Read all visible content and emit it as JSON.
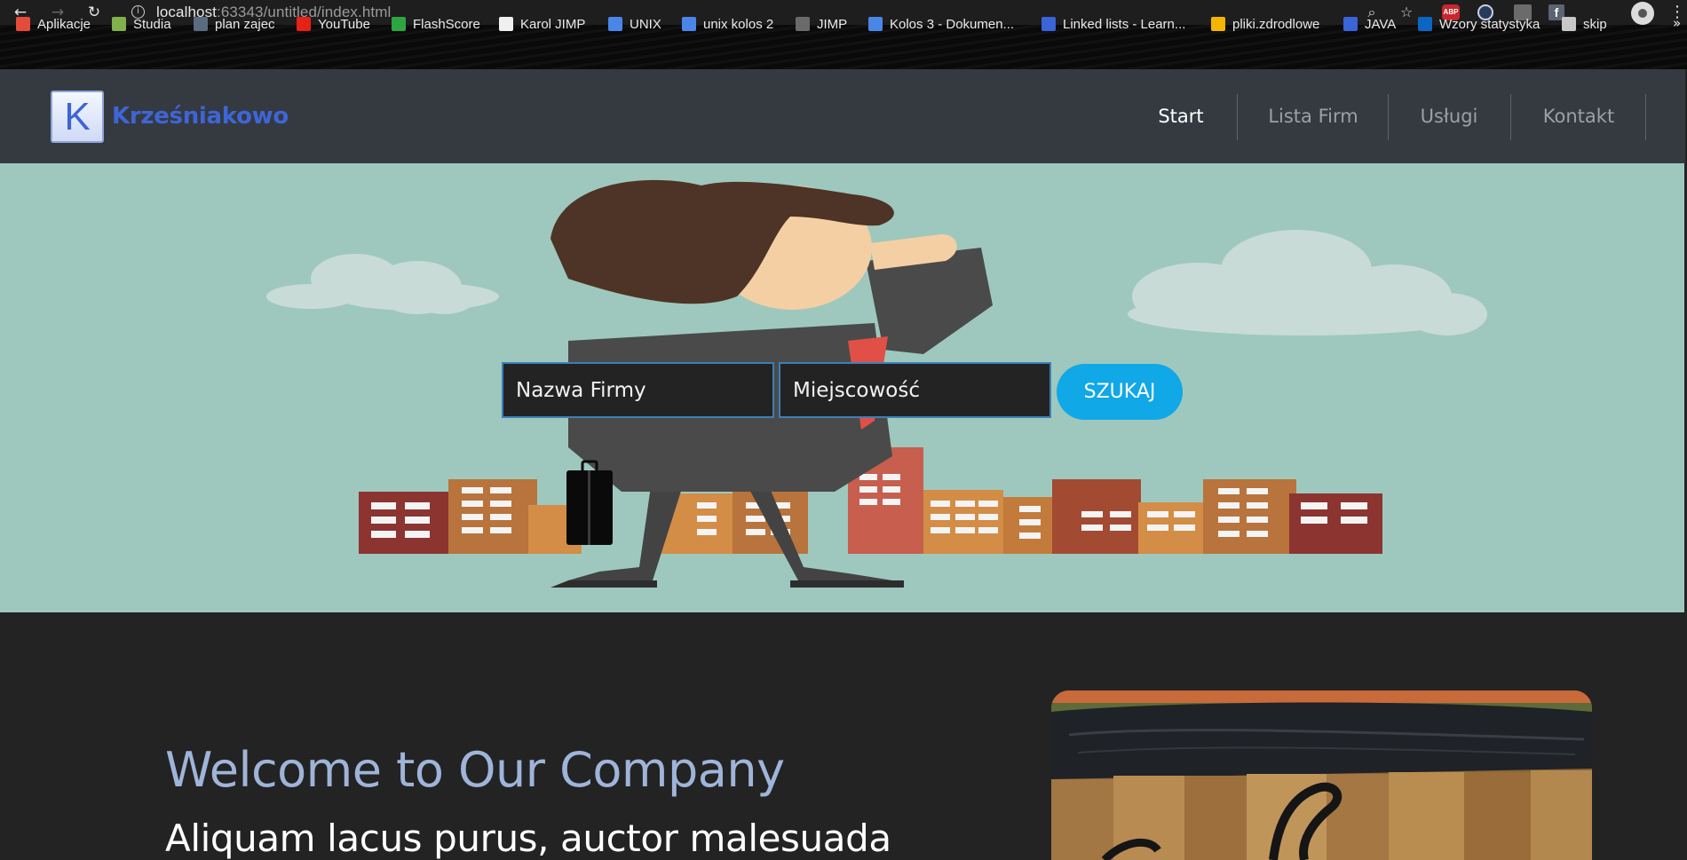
{
  "browser": {
    "url_host": "localhost",
    "url_rest": ":63343/untitled/index.html",
    "bookmarks": [
      {
        "label": "Aplikacje",
        "icon": "apps-grid-icon",
        "color": "#e34b3b"
      },
      {
        "label": "Studia",
        "icon": "notebook-icon",
        "color": "#7fb24a"
      },
      {
        "label": "plan zajec",
        "icon": "phone-icon",
        "color": "#5b6b80"
      },
      {
        "label": "YouTube",
        "icon": "youtube-icon",
        "color": "#e62117"
      },
      {
        "label": "FlashScore",
        "icon": "flashscore-icon",
        "color": "#2ea640"
      },
      {
        "label": "Karol JIMP",
        "icon": "github-icon",
        "color": "#f0f0f0"
      },
      {
        "label": "UNIX",
        "icon": "google-docs-icon",
        "color": "#4a86e8"
      },
      {
        "label": "unix kolos 2",
        "icon": "google-docs-icon",
        "color": "#4a86e8"
      },
      {
        "label": "JIMP",
        "icon": "image-icon",
        "color": "#6a6a6a"
      },
      {
        "label": "Kolos 3 - Dokumen...",
        "icon": "google-docs-icon",
        "color": "#4a86e8"
      },
      {
        "label": "Linked lists - Learn...",
        "icon": "c-letter-icon",
        "color": "#3a64d8"
      },
      {
        "label": "pliki.zdrodlowe",
        "icon": "google-drive-icon",
        "color": "#f4b400"
      },
      {
        "label": "JAVA",
        "icon": "sb-icon",
        "color": "#3a64d8"
      },
      {
        "label": "Wzory statystyka",
        "icon": "linkedin-icon",
        "color": "#0a66c2"
      },
      {
        "label": "skip",
        "icon": "globe-icon",
        "color": "#c8c8c8"
      }
    ],
    "more": "»"
  },
  "site": {
    "logo_letter": "K",
    "brand": "Krześniakowo",
    "nav": [
      {
        "label": "Start",
        "active": true
      },
      {
        "label": "Lista Firm",
        "active": false
      },
      {
        "label": "Usługi",
        "active": false
      },
      {
        "label": "Kontakt",
        "active": false
      }
    ]
  },
  "search": {
    "name_placeholder": "Nazwa Firmy",
    "city_placeholder": "Miejscowość",
    "button": "SZUKAJ"
  },
  "content": {
    "heading": "Welcome to Our Company",
    "subheading": "Aliquam lacus purus, auctor malesuada"
  },
  "colors": {
    "hero_bg": "#9ec8be",
    "header_bg": "#343a40",
    "brand": "#3f65d6",
    "accent_button": "#10a8e6",
    "heading": "#9fb4d9"
  }
}
